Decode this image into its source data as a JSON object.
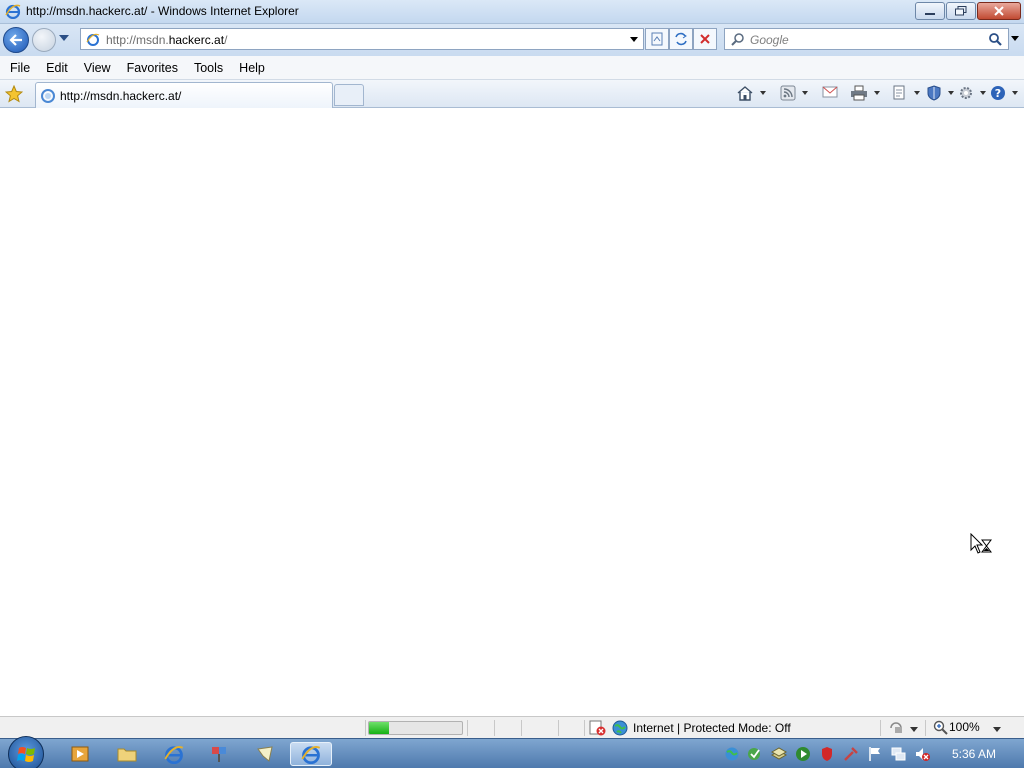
{
  "window": {
    "title": "http://msdn.hackerc.at/ - Windows Internet Explorer",
    "minimize": "minimize",
    "restore": "restore",
    "close": "close"
  },
  "address_bar": {
    "url_prefix": "http://msdn.",
    "url_domain": "hackerc.at",
    "url_suffix": "/"
  },
  "search": {
    "placeholder": "Google"
  },
  "menu": {
    "items": [
      "File",
      "Edit",
      "View",
      "Favorites",
      "Tools",
      "Help"
    ]
  },
  "tabs": {
    "active_label": "http://msdn.hackerc.at/"
  },
  "command_bar": {
    "icons": [
      "home-icon",
      "feeds-icon",
      "read-mail-icon",
      "print-icon",
      "page-icon",
      "safety-icon",
      "tools-icon",
      "help-icon"
    ]
  },
  "status_bar": {
    "progress_fraction": 0.22,
    "zone": "Internet | Protected Mode: Off",
    "zoom": "100%"
  },
  "taskbar": {
    "clock": "5:36 AM",
    "buttons": [
      "media-player-icon",
      "explorer-folder-icon",
      "internet-explorer-icon",
      "paint-icon",
      "wizard-icon",
      "internet-explorer-active-icon"
    ]
  },
  "colors": {
    "titlebar": "#c4d8ef",
    "taskbar": "#4e79ad",
    "progress": "#16b114"
  }
}
